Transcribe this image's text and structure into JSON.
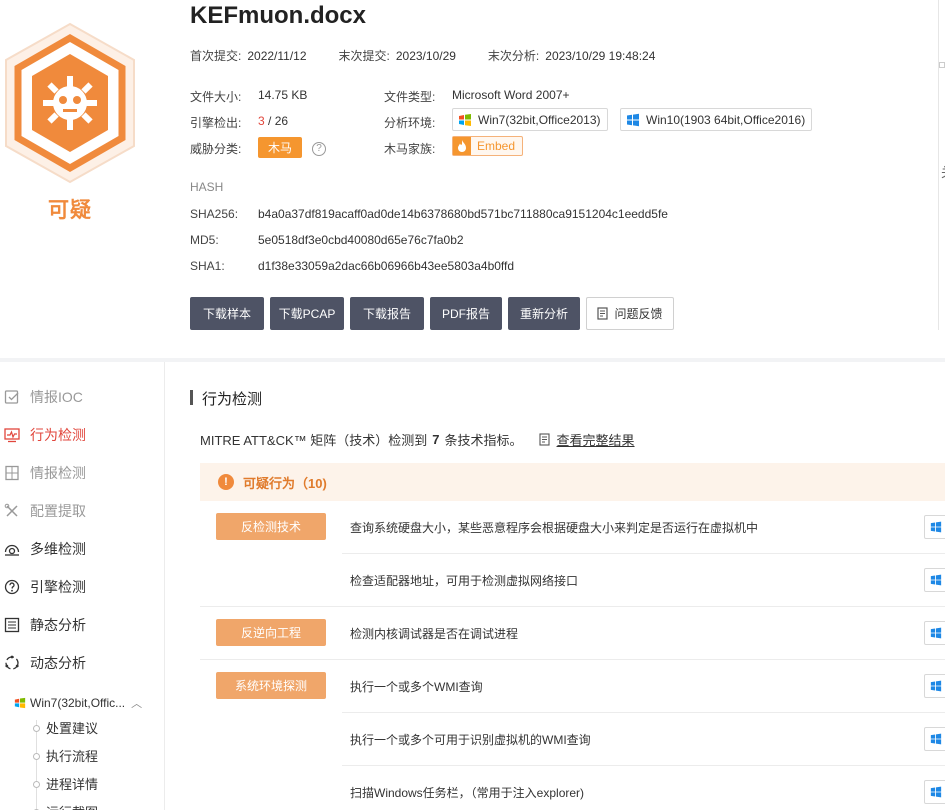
{
  "file": {
    "name": "KEFmuon.docx",
    "verdict": "可疑",
    "dates": [
      {
        "label": "首次提交:",
        "value": "2022/11/12"
      },
      {
        "label": "末次提交:",
        "value": "2023/10/29"
      },
      {
        "label": "末次分析:",
        "value": "2023/10/29 19:48:24"
      }
    ],
    "size_label": "文件大小:",
    "size_value": "14.75 KB",
    "engines_label": "引擎检出:",
    "engines_hit": "3",
    "engines_sep": " / ",
    "engines_total": "26",
    "threat_label": "威胁分类:",
    "threat_value": "木马",
    "help_icon": "?",
    "type_label": "文件类型:",
    "type_value": "Microsoft Word 2007+",
    "env_label": "分析环境:",
    "env_chips": [
      "Win7(32bit,Office2013)",
      "Win10(1903 64bit,Office2016)"
    ],
    "family_label": "木马家族:",
    "family_value": "Embed"
  },
  "hash": {
    "title": "HASH",
    "rows": [
      {
        "label": "SHA256:",
        "value": "b4a0a37df819acaff0ad0de14b6378680bd571bc711880ca9151204c1eedd5fe"
      },
      {
        "label": "MD5:",
        "value": "5e0518df3e0cbd40080d65e76c7fa0b2"
      },
      {
        "label": "SHA1:",
        "value": "d1f38e33059a2dac66b06966b43ee5803a4b0ffd"
      }
    ]
  },
  "actions": [
    "下载样本",
    "下载PCAP",
    "下载报告",
    "PDF报告",
    "重新分析",
    "问题反馈"
  ],
  "right_edge_mark": "关",
  "sidebar": {
    "items": [
      "情报IOC",
      "行为检测",
      "情报检测",
      "配置提取",
      "多维检测",
      "引擎检测",
      "静态分析",
      "动态分析"
    ],
    "env": "Win7(32bit,Offic...",
    "sub_items": [
      "处置建议",
      "执行流程",
      "进程详情",
      "运行截图"
    ]
  },
  "main": {
    "section_title": "行为检测",
    "mitre_prefix": "MITRE ATT&CK™ 矩阵（技术）检测到",
    "mitre_count": "7",
    "mitre_suffix": "条技术指标。",
    "mitre_link": "查看完整结果",
    "suspicious_label": "可疑行为（10)",
    "rows": [
      {
        "category": "反检测技术",
        "desc": "查询系统硬盘大小，某些恶意程序会根据硬盘大小来判定是否运行在虚拟机中"
      },
      {
        "category": "",
        "desc": "检查适配器地址，可用于检测虚拟网络接口"
      },
      {
        "category": "反逆向工程",
        "desc": "检测内核调试器是否在调试进程"
      },
      {
        "category": "系统环境探测",
        "desc": "执行一个或多个WMI查询"
      },
      {
        "category": "",
        "desc": "执行一个或多个可用于识别虚拟机的WMI查询"
      },
      {
        "category": "",
        "desc": "扫描Windows任务栏，（常用于注入explorer)"
      }
    ]
  },
  "colors": {
    "accent_orange": "#f5962f",
    "active_red": "#e1463c",
    "button_dark": "#4e5365"
  }
}
